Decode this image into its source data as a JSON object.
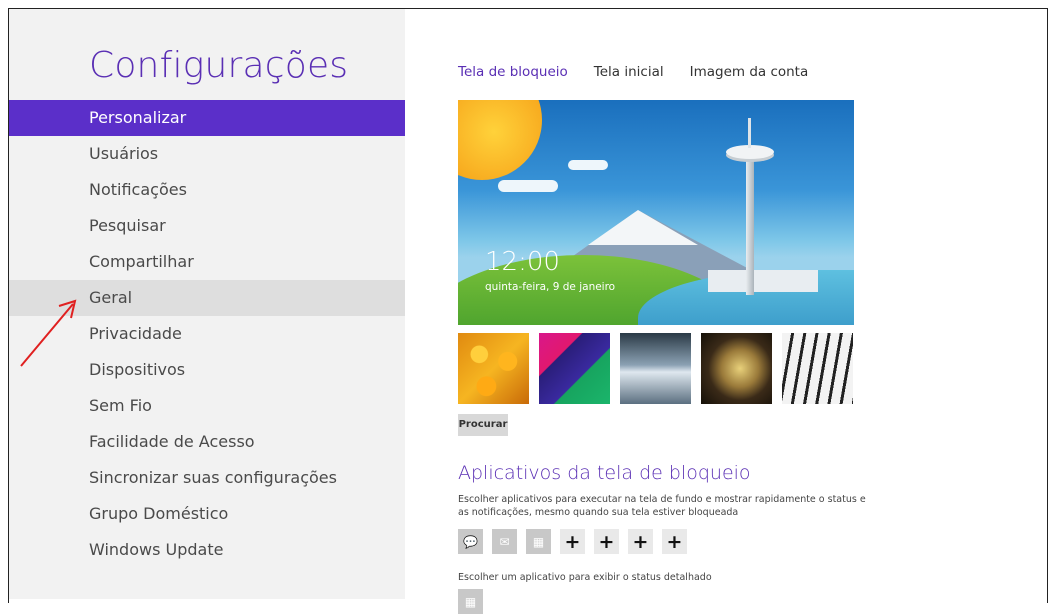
{
  "sidebar": {
    "title": "Configurações",
    "items": [
      {
        "label": "Personalizar"
      },
      {
        "label": "Usuários"
      },
      {
        "label": "Notificações"
      },
      {
        "label": "Pesquisar"
      },
      {
        "label": "Compartilhar"
      },
      {
        "label": "Geral"
      },
      {
        "label": "Privacidade"
      },
      {
        "label": "Dispositivos"
      },
      {
        "label": "Sem Fio"
      },
      {
        "label": "Facilidade de Acesso"
      },
      {
        "label": "Sincronizar suas configurações"
      },
      {
        "label": "Grupo Doméstico"
      },
      {
        "label": "Windows Update"
      }
    ],
    "active_index": 0,
    "highlight_index": 5
  },
  "tabs": [
    {
      "label": "Tela de bloqueio"
    },
    {
      "label": "Tela inicial"
    },
    {
      "label": "Imagem da conta"
    }
  ],
  "lock_preview": {
    "time": "12:00",
    "date": "quinta-feira, 9 de janeiro"
  },
  "browse_button": "Procurar",
  "lock_apps": {
    "title": "Aplicativos da tela de bloqueio",
    "description": "Escolher aplicativos para executar na tela de fundo e mostrar rapidamente o status e as notificações, mesmo quando sua tela estiver bloqueada",
    "slots": [
      {
        "icon": "message-icon",
        "glyph": "💬"
      },
      {
        "icon": "mail-icon",
        "glyph": "✉"
      },
      {
        "icon": "calendar-icon",
        "glyph": "▦"
      },
      {
        "icon": "plus-icon",
        "glyph": "+"
      },
      {
        "icon": "plus-icon",
        "glyph": "+"
      },
      {
        "icon": "plus-icon",
        "glyph": "+"
      },
      {
        "icon": "plus-icon",
        "glyph": "+"
      }
    ],
    "detail_text": "Escolher um aplicativo para exibir o status detalhado"
  },
  "colors": {
    "accent": "#5b2fc9",
    "title": "#5a2fb4",
    "annotation_arrow": "#e02020"
  }
}
